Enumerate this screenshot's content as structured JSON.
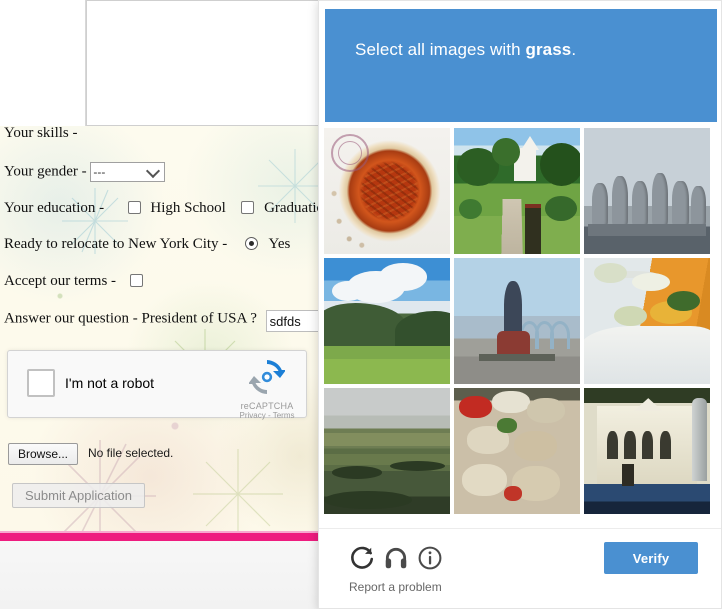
{
  "form": {
    "fields": [
      {
        "label": "Your skills -",
        "type": "textarea",
        "value": ""
      },
      {
        "label": "Your gender -",
        "type": "select",
        "value": "---"
      },
      {
        "label": "Your education -",
        "type": "checkboxes",
        "options": [
          {
            "label": "High School",
            "checked": false
          },
          {
            "label": "Graduation",
            "checked": false
          }
        ]
      },
      {
        "label": "Ready to relocate to New York City -",
        "type": "radio",
        "options": [
          {
            "label": "Yes",
            "checked": true
          }
        ]
      },
      {
        "label": "Accept our terms -",
        "type": "checkbox",
        "checked": false
      },
      {
        "label": "Answer our question - President of USA ?",
        "type": "text",
        "value": "sdfds"
      }
    ],
    "recaptcha": {
      "checkbox_label": "I'm not a robot",
      "brand": "reCAPTCHA",
      "legal": "Privacy - Terms"
    },
    "file_upload": {
      "button_label": "Browse...",
      "status_text": "No file selected."
    },
    "submit_label": "Submit Application"
  },
  "captcha": {
    "prompt_prefix": "Select all images with ",
    "prompt_target": "grass",
    "prompt_suffix": ".",
    "header_color": "#4a90d1",
    "verify_label": "Verify",
    "report_label": "Report a problem",
    "icons": [
      {
        "name": "reload-icon",
        "title": "Get a new challenge"
      },
      {
        "name": "audio-icon",
        "title": "Get an audio challenge"
      },
      {
        "name": "info-icon",
        "title": "Help"
      }
    ],
    "tiles": [
      {
        "index": 1,
        "alt": "pecan pie on a plate",
        "selected": false
      },
      {
        "index": 2,
        "alt": "park garden with green grass lawn and trees",
        "selected": false
      },
      {
        "index": 3,
        "alt": "grey equestrian statue group",
        "selected": false
      },
      {
        "index": 4,
        "alt": "mountain valley with grass field and clouds",
        "selected": false
      },
      {
        "index": 5,
        "alt": "statue monument on plaza",
        "selected": false
      },
      {
        "index": 6,
        "alt": "buffet table with food platters",
        "selected": false
      },
      {
        "index": 7,
        "alt": "countryside fields landscape",
        "selected": false
      },
      {
        "index": 8,
        "alt": "market stall with food items",
        "selected": false
      },
      {
        "index": 9,
        "alt": "white colonial building facade",
        "selected": false
      }
    ]
  },
  "theme": {
    "pink_stripe": "#ee1c7f",
    "accent_blue": "#4a90d1",
    "page_background": "#fdfbee"
  }
}
